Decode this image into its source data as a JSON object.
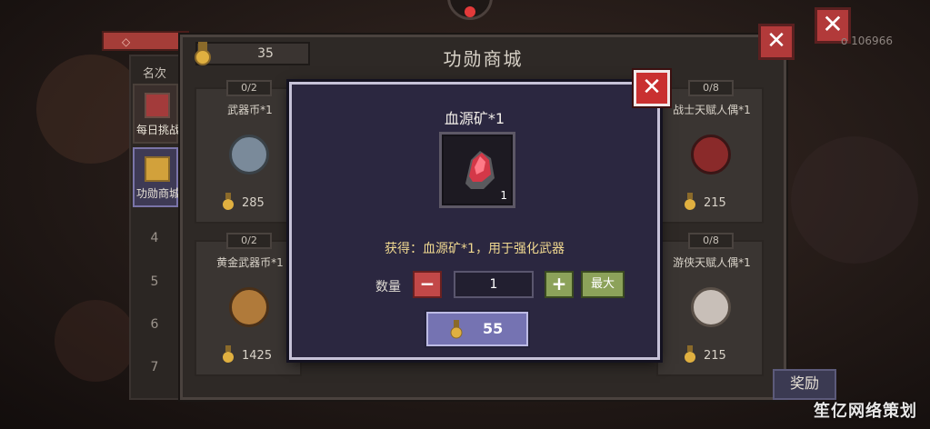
{
  "player_id": "o 106966",
  "watermark": "笙亿网络策划",
  "outer_close_icon": "close-icon",
  "rank_column": {
    "header": "名次",
    "tabs": [
      {
        "label": "每日挑战",
        "icon": "daily-challenge-icon"
      },
      {
        "label": "功勋商城",
        "icon": "medal-icon",
        "active": true
      }
    ],
    "numbers": [
      "4",
      "5",
      "6",
      "7"
    ]
  },
  "shop": {
    "title": "功勋商城",
    "currency": "35",
    "reward_button": "奖励",
    "cards": [
      {
        "count": "0/2",
        "name": "武器币*1",
        "price": "285",
        "art_color": "#7a8a9a"
      },
      {
        "count": "0/8",
        "name": "战士天赋人偶*1",
        "price": "215",
        "art_color": "#8a2a2a"
      },
      {
        "count": "0/2",
        "name": "黄金武器币*1",
        "price": "1425",
        "art_color": "#b07a3a"
      },
      {
        "count": "0/8",
        "name": "游侠天赋人偶*1",
        "price": "215",
        "art_color": "#c8bfb8"
      }
    ]
  },
  "popup": {
    "title": "血源矿*1",
    "item_quantity": "1",
    "description": "获得：血源矿*1，用于强化武器",
    "quantity_label": "数量",
    "quantity_value": "1",
    "max_label": "最大",
    "price": "55",
    "colors": {
      "accent": "#7573b2",
      "close": "#c93030",
      "confirm": "#8ca25a"
    }
  }
}
